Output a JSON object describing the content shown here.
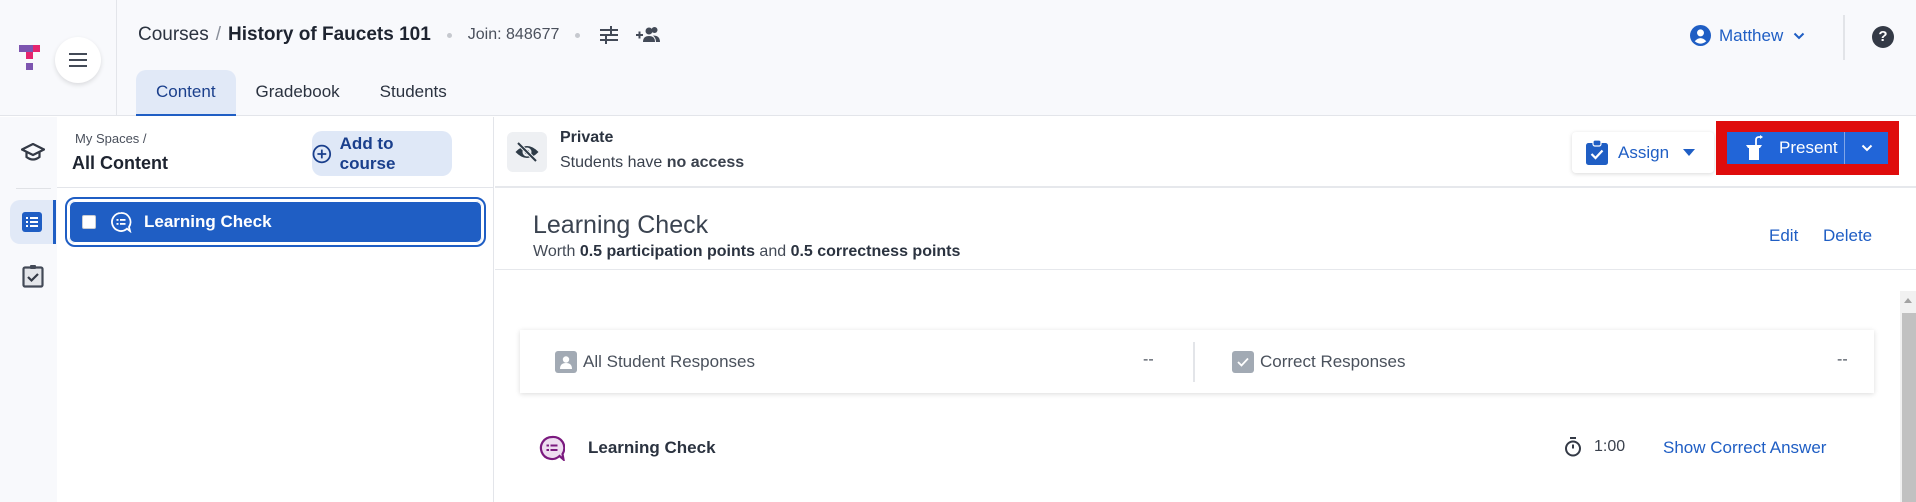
{
  "header": {
    "breadcrumb_root": "Courses",
    "breadcrumb_sep": "/",
    "course_title": "History of Faucets 101",
    "join_code": "Join: 848677",
    "tabs": [
      {
        "label": "Content",
        "active": true
      },
      {
        "label": "Gradebook",
        "active": false
      },
      {
        "label": "Students",
        "active": false
      }
    ],
    "user_name": "Matthew",
    "help_glyph": "?"
  },
  "rail": {
    "items": [
      {
        "icon": "graduation-cap-icon",
        "active": false
      },
      {
        "icon": "list-icon",
        "active": true
      },
      {
        "icon": "clipboard-check-icon",
        "active": false
      }
    ]
  },
  "list_panel": {
    "crumb": "My Spaces /",
    "title": "All Content",
    "add_button": "Add to course",
    "items": [
      {
        "label": "Learning Check",
        "selected": true,
        "checked": false
      }
    ]
  },
  "status": {
    "title": "Private",
    "sub_prefix": "Students have ",
    "sub_bold": "no access"
  },
  "actions": {
    "assign": "Assign",
    "present": "Present"
  },
  "item": {
    "title": "Learning Check",
    "worth_prefix": "Worth ",
    "participation": "0.5 participation points",
    "worth_mid": " and ",
    "correctness": "0.5 correctness points",
    "edit": "Edit",
    "delete": "Delete"
  },
  "responses": {
    "all_label": "All Student Responses",
    "all_value": "--",
    "correct_label": "Correct Responses",
    "correct_value": "--"
  },
  "question": {
    "label": "Learning Check",
    "time": "1:00",
    "show_answer": "Show Correct Answer"
  },
  "colors": {
    "accent": "#1f5ec4",
    "present_bg": "#2165d8",
    "highlight_frame": "#df0c0c",
    "logo_purple": "#7d55b0",
    "logo_pink": "#e5256e",
    "question_icon": "#7b1a7f"
  }
}
